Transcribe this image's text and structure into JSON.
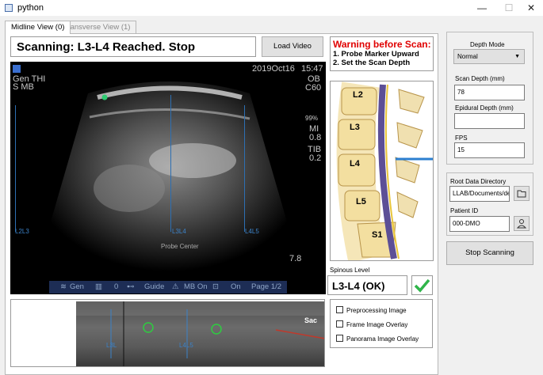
{
  "window": {
    "title": "python",
    "controls": {
      "minimize": "—",
      "maximize": "☐",
      "close": "✕"
    }
  },
  "tabs": [
    {
      "label": "Midline View (0)"
    },
    {
      "label": "Transverse View (1)"
    }
  ],
  "status_message": "Scanning: L3-L4 Reached. Stop",
  "load_button": "Load Video Source",
  "warning": {
    "title": "Warning before Scan:",
    "lines": [
      "1. Probe Marker Upward",
      "2. Set the Scan Depth"
    ]
  },
  "ultrasound": {
    "left_text": [
      "Gen  THI",
      "S      MB"
    ],
    "date": "2019Oct16",
    "time": "15:47",
    "right_text": [
      "OB",
      "C60"
    ],
    "percent": "99%",
    "mi": [
      "MI",
      "0.8"
    ],
    "tib": [
      "TIB",
      "0.2"
    ],
    "labels": [
      "L2L3",
      "L3L4",
      "L4L5"
    ],
    "probe_center": "Probe Center",
    "depth": "7.8",
    "toolbar": [
      "Gen",
      "0",
      "Guide",
      "MB On",
      "On",
      "Page 1/2"
    ]
  },
  "spine_labels": [
    "L2",
    "L3",
    "L4",
    "L5",
    "S1"
  ],
  "spinous": {
    "label": "Spinous Level",
    "value": "L3-L4 (OK)"
  },
  "panorama": {
    "labels": [
      "L3L",
      "L4L5"
    ],
    "sac_label": "Sac"
  },
  "checkboxes": [
    "Preprocessing Image",
    "Frame Image Overlay",
    "Panorama Image Overlay"
  ],
  "settings": {
    "depth_mode_label": "Depth Mode",
    "depth_mode_value": "Normal",
    "scan_depth_label": "Scan Depth (mm)",
    "scan_depth_value": "78",
    "epidural_depth_label": "Epidural Depth (mm)",
    "epidural_depth_value": "",
    "fps_label": "FPS",
    "fps_value": "15",
    "root_dir_label": "Root Data Directory",
    "root_dir_value": "LLAB/Documents/demo",
    "patient_id_label": "Patient ID",
    "patient_id_value": "000-DMO",
    "stop_button": "Stop Scanning"
  }
}
